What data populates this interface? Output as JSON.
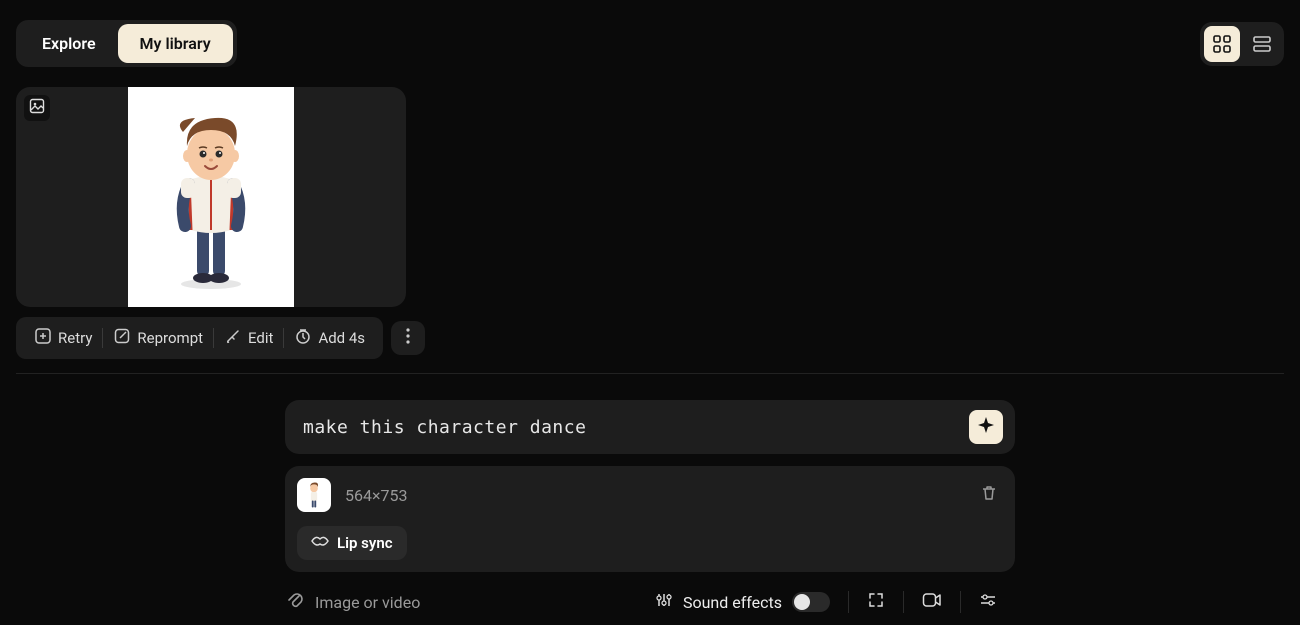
{
  "topbar": {
    "tabs": {
      "explore": "Explore",
      "library": "My library",
      "active": "library"
    },
    "view": {
      "active": "grid"
    }
  },
  "card": {
    "badge_icon": "image-icon"
  },
  "actions": {
    "retry": "Retry",
    "reprompt": "Reprompt",
    "edit": "Edit",
    "add4s": "Add 4s"
  },
  "prompt": {
    "text": "make this character dance"
  },
  "attachment": {
    "dimensions": "564×753",
    "lip_sync": "Lip sync"
  },
  "footer": {
    "upload_label": "Image or video",
    "sound_effects": "Sound effects",
    "sound_effects_on": false
  }
}
